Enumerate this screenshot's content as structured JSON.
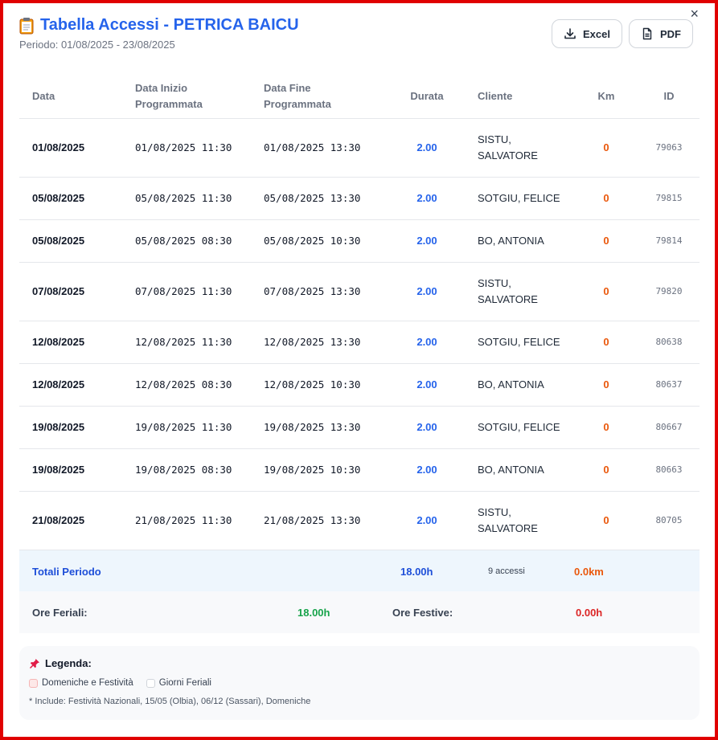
{
  "header": {
    "title": "Tabella Accessi - PETRICA BAICU",
    "period": "Periodo: 01/08/2025 - 23/08/2025",
    "excel_label": "Excel",
    "pdf_label": "PDF",
    "close_label": "×"
  },
  "table": {
    "columns": {
      "date": "Data",
      "start_1": "Data Inizio",
      "start_2": "Programmata",
      "end_1": "Data Fine",
      "end_2": "Programmata",
      "duration": "Durata",
      "client": "Cliente",
      "km": "Km",
      "id": "ID"
    },
    "rows": [
      {
        "date": "01/08/2025",
        "start": "01/08/2025 11:30",
        "end": "01/08/2025 13:30",
        "duration": "2.00",
        "client_1": "SISTU,",
        "client_2": "SALVATORE",
        "km": "0",
        "id": "79063"
      },
      {
        "date": "05/08/2025",
        "start": "05/08/2025 11:30",
        "end": "05/08/2025 13:30",
        "duration": "2.00",
        "client_1": "SOTGIU, FELICE",
        "client_2": "",
        "km": "0",
        "id": "79815"
      },
      {
        "date": "05/08/2025",
        "start": "05/08/2025 08:30",
        "end": "05/08/2025 10:30",
        "duration": "2.00",
        "client_1": "BO, ANTONIA",
        "client_2": "",
        "km": "0",
        "id": "79814"
      },
      {
        "date": "07/08/2025",
        "start": "07/08/2025 11:30",
        "end": "07/08/2025 13:30",
        "duration": "2.00",
        "client_1": "SISTU,",
        "client_2": "SALVATORE",
        "km": "0",
        "id": "79820"
      },
      {
        "date": "12/08/2025",
        "start": "12/08/2025 11:30",
        "end": "12/08/2025 13:30",
        "duration": "2.00",
        "client_1": "SOTGIU, FELICE",
        "client_2": "",
        "km": "0",
        "id": "80638"
      },
      {
        "date": "12/08/2025",
        "start": "12/08/2025 08:30",
        "end": "12/08/2025 10:30",
        "duration": "2.00",
        "client_1": "BO, ANTONIA",
        "client_2": "",
        "km": "0",
        "id": "80637"
      },
      {
        "date": "19/08/2025",
        "start": "19/08/2025 11:30",
        "end": "19/08/2025 13:30",
        "duration": "2.00",
        "client_1": "SOTGIU, FELICE",
        "client_2": "",
        "km": "0",
        "id": "80667"
      },
      {
        "date": "19/08/2025",
        "start": "19/08/2025 08:30",
        "end": "19/08/2025 10:30",
        "duration": "2.00",
        "client_1": "BO, ANTONIA",
        "client_2": "",
        "km": "0",
        "id": "80663"
      },
      {
        "date": "21/08/2025",
        "start": "21/08/2025 11:30",
        "end": "21/08/2025 13:30",
        "duration": "2.00",
        "client_1": "SISTU,",
        "client_2": "SALVATORE",
        "km": "0",
        "id": "80705"
      }
    ]
  },
  "totals": {
    "label": "Totali Periodo",
    "hours": "18.00h",
    "count": "9 accessi",
    "km": "0.0km"
  },
  "hours": {
    "feriali_label": "Ore Feriali:",
    "feriali_value": "18.00h",
    "festive_label": "Ore Festive:",
    "festive_value": "0.00h"
  },
  "legend": {
    "title": "Legenda:",
    "item_festive": "Domeniche e Festività",
    "item_feriali": "Giorni Feriali",
    "note": "* Include: Festività Nazionali, 15/05 (Olbia), 06/12 (Sassari), Domeniche"
  },
  "colors": {
    "accent": "#2563eb",
    "km": "#ea580c",
    "feriali": "#16a34a",
    "festive": "#dc2626"
  },
  "icons": {
    "title": "clipboard-icon",
    "excel": "download-icon",
    "pdf": "document-icon",
    "legend": "pushpin-icon"
  }
}
